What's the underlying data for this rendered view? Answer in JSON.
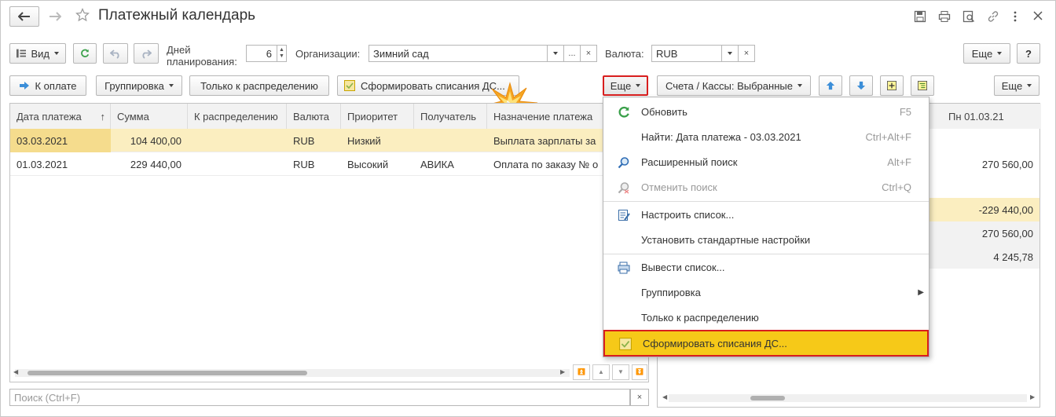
{
  "window": {
    "title": "Платежный календарь"
  },
  "toolbar1": {
    "view_label": "Вид",
    "days_label_1": "Дней",
    "days_label_2": "планирования:",
    "days_value": "6",
    "org_label": "Организации:",
    "org_value": "Зимний сад",
    "org_select_glyph": "...",
    "clear_glyph": "×",
    "currency_label": "Валюта:",
    "currency_value": "RUB",
    "more_label": "Еще",
    "help_label": "?"
  },
  "toolbar2": {
    "to_pay_label": "К оплате",
    "grouping_label": "Группировка",
    "only_dist_label": "Только к распределению",
    "form_writeoff_label": "Сформировать списания ДС...",
    "more_label": "Еще",
    "accounts_label": "Счета / Кассы: Выбранные",
    "more2_label": "Еще"
  },
  "table": {
    "columns": [
      "Дата платежа",
      "Сумма",
      "К распределению",
      "Валюта",
      "Приоритет",
      "Получатель",
      "Назначение платежа"
    ],
    "sort_indicator": "↑",
    "rows": [
      {
        "date": "03.03.2021",
        "sum": "104 400,00",
        "dist": "",
        "currency": "RUB",
        "priority": "Низкий",
        "recipient": "",
        "purpose": "Выплата зарплаты за"
      },
      {
        "date": "01.03.2021",
        "sum": "229 440,00",
        "dist": "",
        "currency": "RUB",
        "priority": "Высокий",
        "recipient": "АВИКА",
        "purpose": "Оплата по заказу № о"
      }
    ]
  },
  "right_table": {
    "header": "Пн 01.03.21",
    "values": [
      "270 560,00",
      "-229 440,00",
      "270 560,00",
      "4 245,78"
    ]
  },
  "search": {
    "placeholder": "Поиск (Ctrl+F)",
    "clear_glyph": "×"
  },
  "menu": {
    "items": [
      {
        "label": "Обновить",
        "shortcut": "F5",
        "icon": "refresh-icon"
      },
      {
        "label": "Найти: Дата платежа - 03.03.2021",
        "shortcut": "Ctrl+Alt+F",
        "icon": ""
      },
      {
        "label": "Расширенный поиск",
        "shortcut": "Alt+F",
        "icon": "search-icon"
      },
      {
        "label": "Отменить поиск",
        "shortcut": "Ctrl+Q",
        "icon": "cancel-search-icon"
      },
      {
        "label": "Настроить список...",
        "shortcut": "",
        "icon": "settings-list-icon"
      },
      {
        "label": "Установить стандартные настройки",
        "shortcut": "",
        "icon": ""
      },
      {
        "label": "Вывести список...",
        "shortcut": "",
        "icon": "print-list-icon"
      },
      {
        "label": "Группировка",
        "shortcut": "",
        "icon": ""
      },
      {
        "label": "Только к распределению",
        "shortcut": "",
        "icon": ""
      },
      {
        "label": "Сформировать списания ДС...",
        "shortcut": "",
        "icon": "checkbox-icon"
      }
    ]
  },
  "colors": {
    "highlight_row": "#fbeec0",
    "selected_cell": "#f5dc8d",
    "menu_highlight": "#f6c918",
    "red_frame": "#d81e1e",
    "arrow_blue": "#3b8ed8",
    "green_refresh": "#3aa04a"
  }
}
